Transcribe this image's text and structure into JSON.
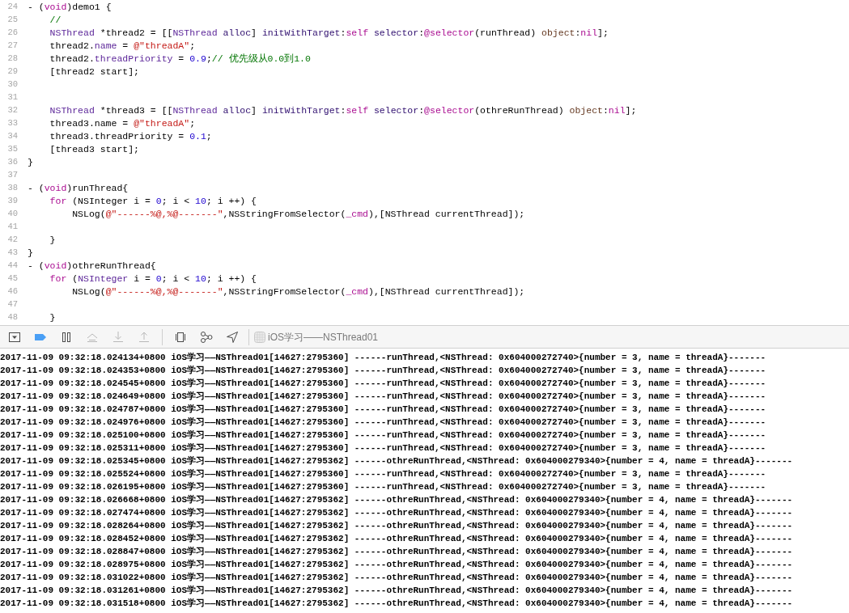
{
  "editor": {
    "lines": [
      {
        "number": "24",
        "segments": [
          {
            "text": "- (",
            "kind": "plain"
          },
          {
            "text": "void",
            "kind": "keyword"
          },
          {
            "text": ")demo1 {",
            "kind": "plain"
          }
        ]
      },
      {
        "number": "25",
        "segments": [
          {
            "text": "    //",
            "kind": "comment"
          }
        ]
      },
      {
        "number": "26",
        "segments": [
          {
            "text": "    NSThread",
            "kind": "class"
          },
          {
            "text": " *thread2 = [[",
            "kind": "plain"
          },
          {
            "text": "NSThread ",
            "kind": "class"
          },
          {
            "text": "alloc",
            "kind": "method"
          },
          {
            "text": "] ",
            "kind": "plain"
          },
          {
            "text": "initWithTarget",
            "kind": "method"
          },
          {
            "text": ":",
            "kind": "plain"
          },
          {
            "text": "self ",
            "kind": "keyword"
          },
          {
            "text": "selector",
            "kind": "method"
          },
          {
            "text": ":",
            "kind": "plain"
          },
          {
            "text": "@selector",
            "kind": "keyword"
          },
          {
            "text": "(runThread) ",
            "kind": "plain"
          },
          {
            "text": "object",
            "kind": "label"
          },
          {
            "text": ":",
            "kind": "plain"
          },
          {
            "text": "nil",
            "kind": "keyword"
          },
          {
            "text": "];",
            "kind": "plain"
          }
        ]
      },
      {
        "number": "27",
        "segments": [
          {
            "text": "    thread2.",
            "kind": "plain"
          },
          {
            "text": "name",
            "kind": "member"
          },
          {
            "text": " = ",
            "kind": "plain"
          },
          {
            "text": "@\"threadA\"",
            "kind": "string"
          },
          {
            "text": ";",
            "kind": "plain"
          }
        ]
      },
      {
        "number": "28",
        "segments": [
          {
            "text": "    thread2.",
            "kind": "plain"
          },
          {
            "text": "threadPriority",
            "kind": "member"
          },
          {
            "text": " = ",
            "kind": "plain"
          },
          {
            "text": "0.9",
            "kind": "number"
          },
          {
            "text": ";",
            "kind": "plain"
          },
          {
            "text": "// 优先级从0.0到1.0",
            "kind": "comment"
          }
        ]
      },
      {
        "number": "29",
        "segments": [
          {
            "text": "    [thread2 start];",
            "kind": "plain"
          }
        ]
      },
      {
        "number": "30"
      },
      {
        "number": "31"
      },
      {
        "number": "32",
        "segments": [
          {
            "text": "    NSThread",
            "kind": "class"
          },
          {
            "text": " *thread3 = [[",
            "kind": "plain"
          },
          {
            "text": "NSThread ",
            "kind": "class"
          },
          {
            "text": "alloc",
            "kind": "method"
          },
          {
            "text": "] ",
            "kind": "plain"
          },
          {
            "text": "initWithTarget",
            "kind": "method"
          },
          {
            "text": ":",
            "kind": "plain"
          },
          {
            "text": "self ",
            "kind": "keyword"
          },
          {
            "text": "selector",
            "kind": "method"
          },
          {
            "text": ":",
            "kind": "plain"
          },
          {
            "text": "@selector",
            "kind": "keyword"
          },
          {
            "text": "(othreRunThread) ",
            "kind": "plain"
          },
          {
            "text": "object",
            "kind": "label"
          },
          {
            "text": ":",
            "kind": "plain"
          },
          {
            "text": "nil",
            "kind": "keyword"
          },
          {
            "text": "];",
            "kind": "plain"
          }
        ]
      },
      {
        "number": "33",
        "segments": [
          {
            "text": "    thread3.name = ",
            "kind": "plain"
          },
          {
            "text": "@\"threadA\"",
            "kind": "string"
          },
          {
            "text": ";",
            "kind": "plain"
          }
        ]
      },
      {
        "number": "34",
        "segments": [
          {
            "text": "    thread3.threadPriority = ",
            "kind": "plain"
          },
          {
            "text": "0.1",
            "kind": "number"
          },
          {
            "text": ";",
            "kind": "plain"
          }
        ]
      },
      {
        "number": "35",
        "segments": [
          {
            "text": "    [thread3 start];",
            "kind": "plain"
          }
        ]
      },
      {
        "number": "36",
        "segments": [
          {
            "text": "}",
            "kind": "plain"
          }
        ]
      },
      {
        "number": "37"
      },
      {
        "number": "38",
        "segments": [
          {
            "text": "- (",
            "kind": "plain"
          },
          {
            "text": "void",
            "kind": "keyword"
          },
          {
            "text": ")runThread{",
            "kind": "plain"
          }
        ]
      },
      {
        "number": "39",
        "segments": [
          {
            "text": "    for",
            "kind": "keyword"
          },
          {
            "text": " (NSInteger i = ",
            "kind": "plain"
          },
          {
            "text": "0",
            "kind": "number"
          },
          {
            "text": "; i < ",
            "kind": "plain"
          },
          {
            "text": "10",
            "kind": "number"
          },
          {
            "text": "; i ++) {",
            "kind": "plain"
          }
        ]
      },
      {
        "number": "40",
        "segments": [
          {
            "text": "        NSLog(",
            "kind": "plain"
          },
          {
            "text": "@\"------%@,%@-------\"",
            "kind": "string"
          },
          {
            "text": ",NSStringFromSelector(",
            "kind": "plain"
          },
          {
            "text": "_cmd",
            "kind": "keyword"
          },
          {
            "text": "),[NSThread currentThread]);",
            "kind": "plain"
          }
        ]
      },
      {
        "number": "41"
      },
      {
        "number": "42",
        "segments": [
          {
            "text": "    }",
            "kind": "plain"
          }
        ]
      },
      {
        "number": "43",
        "segments": [
          {
            "text": "}",
            "kind": "plain"
          }
        ]
      },
      {
        "number": "44",
        "segments": [
          {
            "text": "- (",
            "kind": "plain"
          },
          {
            "text": "void",
            "kind": "keyword"
          },
          {
            "text": ")othreRunThread{",
            "kind": "plain"
          }
        ]
      },
      {
        "number": "45",
        "segments": [
          {
            "text": "    for",
            "kind": "keyword"
          },
          {
            "text": " (",
            "kind": "plain"
          },
          {
            "text": "NSInteger",
            "kind": "class"
          },
          {
            "text": " i = ",
            "kind": "plain"
          },
          {
            "text": "0",
            "kind": "number"
          },
          {
            "text": "; i < ",
            "kind": "plain"
          },
          {
            "text": "10",
            "kind": "number"
          },
          {
            "text": "; i ++) {",
            "kind": "plain"
          }
        ]
      },
      {
        "number": "46",
        "segments": [
          {
            "text": "        NSLog(",
            "kind": "plain"
          },
          {
            "text": "@\"------%@,%@-------\"",
            "kind": "string"
          },
          {
            "text": ",NSStringFromSelector(",
            "kind": "plain"
          },
          {
            "text": "_cmd",
            "kind": "keyword"
          },
          {
            "text": "),[NSThread currentThread]);",
            "kind": "plain"
          }
        ]
      },
      {
        "number": "47"
      },
      {
        "number": "48",
        "segments": [
          {
            "text": "    }",
            "kind": "plain"
          }
        ]
      }
    ]
  },
  "debug_bar": {
    "groups": [
      [
        {
          "kind": "console-toggle",
          "disabled": false
        },
        {
          "kind": "breakpoints",
          "disabled": false,
          "on": true
        },
        {
          "kind": "pause",
          "disabled": false
        },
        {
          "kind": "step-over",
          "disabled": true
        },
        {
          "kind": "step-into",
          "disabled": true
        },
        {
          "kind": "step-out",
          "disabled": true
        }
      ],
      [
        {
          "kind": "view-debugger",
          "disabled": false
        },
        {
          "kind": "memory-graph",
          "disabled": false
        },
        {
          "kind": "location",
          "disabled": false
        }
      ]
    ],
    "process": "iOS学习——NSThread01"
  },
  "console": {
    "lines": [
      "2017-11-09 09:32:18.024134+0800 iOS学习——NSThread01[14627:2795360] ------runThread,<NSThread: 0x604000272740>{number = 3, name = threadA}-------",
      "2017-11-09 09:32:18.024353+0800 iOS学习——NSThread01[14627:2795360] ------runThread,<NSThread: 0x604000272740>{number = 3, name = threadA}-------",
      "2017-11-09 09:32:18.024545+0800 iOS学习——NSThread01[14627:2795360] ------runThread,<NSThread: 0x604000272740>{number = 3, name = threadA}-------",
      "2017-11-09 09:32:18.024649+0800 iOS学习——NSThread01[14627:2795360] ------runThread,<NSThread: 0x604000272740>{number = 3, name = threadA}-------",
      "2017-11-09 09:32:18.024787+0800 iOS学习——NSThread01[14627:2795360] ------runThread,<NSThread: 0x604000272740>{number = 3, name = threadA}-------",
      "2017-11-09 09:32:18.024976+0800 iOS学习——NSThread01[14627:2795360] ------runThread,<NSThread: 0x604000272740>{number = 3, name = threadA}-------",
      "2017-11-09 09:32:18.025100+0800 iOS学习——NSThread01[14627:2795360] ------runThread,<NSThread: 0x604000272740>{number = 3, name = threadA}-------",
      "2017-11-09 09:32:18.025311+0800 iOS学习——NSThread01[14627:2795360] ------runThread,<NSThread: 0x604000272740>{number = 3, name = threadA}-------",
      "2017-11-09 09:32:18.025345+0800 iOS学习——NSThread01[14627:2795362] ------othreRunThread,<NSThread: 0x604000279340>{number = 4, name = threadA}-------",
      "2017-11-09 09:32:18.025524+0800 iOS学习——NSThread01[14627:2795360] ------runThread,<NSThread: 0x604000272740>{number = 3, name = threadA}-------",
      "2017-11-09 09:32:18.026195+0800 iOS学习——NSThread01[14627:2795360] ------runThread,<NSThread: 0x604000272740>{number = 3, name = threadA}-------",
      "2017-11-09 09:32:18.026668+0800 iOS学习——NSThread01[14627:2795362] ------othreRunThread,<NSThread: 0x604000279340>{number = 4, name = threadA}-------",
      "2017-11-09 09:32:18.027474+0800 iOS学习——NSThread01[14627:2795362] ------othreRunThread,<NSThread: 0x604000279340>{number = 4, name = threadA}-------",
      "2017-11-09 09:32:18.028264+0800 iOS学习——NSThread01[14627:2795362] ------othreRunThread,<NSThread: 0x604000279340>{number = 4, name = threadA}-------",
      "2017-11-09 09:32:18.028452+0800 iOS学习——NSThread01[14627:2795362] ------othreRunThread,<NSThread: 0x604000279340>{number = 4, name = threadA}-------",
      "2017-11-09 09:32:18.028847+0800 iOS学习——NSThread01[14627:2795362] ------othreRunThread,<NSThread: 0x604000279340>{number = 4, name = threadA}-------",
      "2017-11-09 09:32:18.028975+0800 iOS学习——NSThread01[14627:2795362] ------othreRunThread,<NSThread: 0x604000279340>{number = 4, name = threadA}-------",
      "2017-11-09 09:32:18.031022+0800 iOS学习——NSThread01[14627:2795362] ------othreRunThread,<NSThread: 0x604000279340>{number = 4, name = threadA}-------",
      "2017-11-09 09:32:18.031261+0800 iOS学习——NSThread01[14627:2795362] ------othreRunThread,<NSThread: 0x604000279340>{number = 4, name = threadA}-------",
      "2017-11-09 09:32:18.031518+0800 iOS学习——NSThread01[14627:2795362] ------othreRunThread,<NSThread: 0x604000279340>{number = 4, name = threadA}-------"
    ]
  }
}
